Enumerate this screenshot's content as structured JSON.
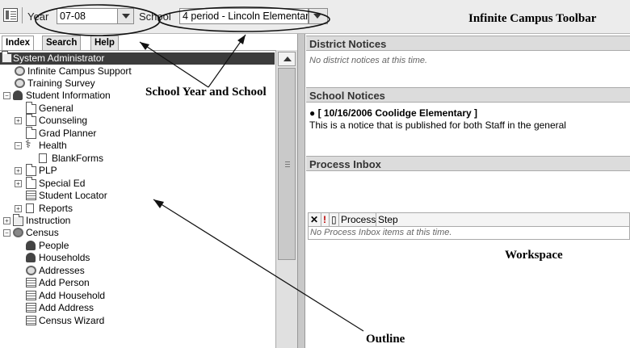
{
  "toolbar": {
    "year_label": "Year",
    "year_value": "07-08",
    "school_label": "School",
    "school_value": "4 period - Lincoln Elementary",
    "title": "Infinite Campus Toolbar"
  },
  "tabs": [
    "Index",
    "Search",
    "Help"
  ],
  "tree": [
    {
      "label": "System Administrator",
      "icon": "admin-icon"
    },
    {
      "label": "Infinite Campus Support",
      "icon": "gear-icon"
    },
    {
      "label": "Training Survey",
      "icon": "gear-icon"
    },
    {
      "label": "Student Information",
      "icon": "person-icon"
    },
    {
      "label": "General",
      "icon": "folder-icon"
    },
    {
      "label": "Counseling",
      "icon": "folder-icon"
    },
    {
      "label": "Grad Planner",
      "icon": "folder-icon"
    },
    {
      "label": "Health",
      "icon": "caduceus-icon"
    },
    {
      "label": "BlankForms",
      "icon": "document-icon"
    },
    {
      "label": "PLP",
      "icon": "folder-icon"
    },
    {
      "label": "Special Ed",
      "icon": "folder-icon"
    },
    {
      "label": "Student Locator",
      "icon": "table-icon"
    },
    {
      "label": "Reports",
      "icon": "document-icon"
    },
    {
      "label": "Instruction",
      "icon": "instruction-icon"
    },
    {
      "label": "Census",
      "icon": "census-icon"
    },
    {
      "label": "People",
      "icon": "person-icon"
    },
    {
      "label": "Households",
      "icon": "person-icon"
    },
    {
      "label": "Addresses",
      "icon": "gear-icon"
    },
    {
      "label": "Add Person",
      "icon": "table-icon"
    },
    {
      "label": "Add Household",
      "icon": "table-icon"
    },
    {
      "label": "Add Address",
      "icon": "table-icon"
    },
    {
      "label": "Census Wizard",
      "icon": "table-icon"
    }
  ],
  "workspace": {
    "district_title": "District Notices",
    "district_empty": "No district notices at this time.",
    "school_title": "School Notices",
    "school_notice_title": "[ 10/16/2006 Coolidge Elementary ]",
    "school_notice_body": "This is a notice that is published for both Staff in the general",
    "inbox_title": "Process Inbox",
    "inbox_columns": [
      "Process",
      "Step"
    ],
    "inbox_empty": "No Process Inbox items at this time."
  },
  "annotations": {
    "school_year": "School Year and School",
    "workspace": "Workspace",
    "outline": "Outline"
  }
}
